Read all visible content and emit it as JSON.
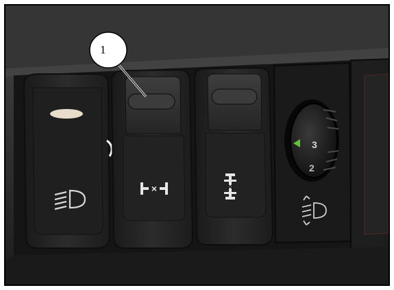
{
  "photo": {
    "callout_label": "1",
    "dial_marks": [
      "3",
      "2"
    ],
    "icons": [
      "headlight-icon",
      "axle-diff-lock-icon",
      "center-diff-lock-icon",
      "headlight-level-icon",
      "indicator-lamp"
    ],
    "colors": {
      "frame": "#000000",
      "panel": "#2a2a2a",
      "switch": "#262626",
      "dial_pointer": "#5ec23a",
      "lamp": "#e8dccb"
    }
  }
}
